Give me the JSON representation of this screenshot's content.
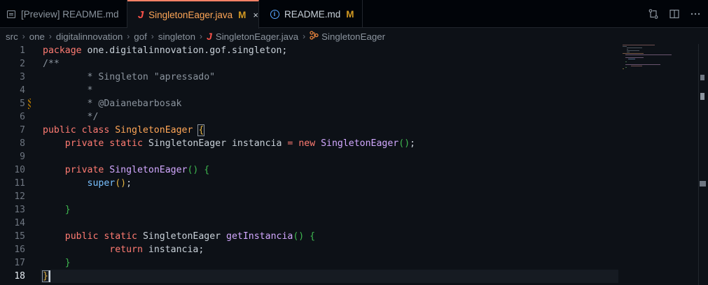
{
  "tabs": [
    {
      "label": "[Preview] README.md",
      "icon": "preview-icon",
      "active": false
    },
    {
      "label": "SingletonEager.java",
      "icon": "java-icon",
      "modified": "M",
      "active": true,
      "close": "×"
    },
    {
      "label": "README.md",
      "icon": "info-icon",
      "modified": "M",
      "active": false
    }
  ],
  "breadcrumb": [
    "src",
    "one",
    "digitalinnovation",
    "gof",
    "singleton",
    "SingletonEager.java",
    "SingletonEager"
  ],
  "breadcrumb_sep": "›",
  "current_line": 18,
  "line_numbers": [
    "1",
    "2",
    "3",
    "4",
    "5",
    "6",
    "7",
    "8",
    "9",
    "10",
    "11",
    "12",
    "13",
    "14",
    "15",
    "16",
    "17",
    "18"
  ],
  "code": {
    "l1_kw": "package",
    "l1_rest": " one.digitalinnovation.gof.singleton;",
    "l2": "/**",
    "l3": "        * Singleton \"apressado\"",
    "l4": "        *",
    "l5": "        * @Daianebarbosak",
    "l6": "        */",
    "l7_kw": "public class",
    "l7_cls": "SingletonEager",
    "l7_br": "{",
    "l8_kw": "private static",
    "l8_cls": "SingletonEager",
    "l8_id": "instancia",
    "l8_op": "=",
    "l8_new": "new",
    "l8_fn": "SingletonEager",
    "l8_par": "()",
    "l8_end": ";",
    "l10_kw": "private",
    "l10_fn": "SingletonEager",
    "l10_par": "()",
    "l10_br": "{",
    "l11_sp": "super",
    "l11_par": "()",
    "l11_end": ";",
    "l13_br": "}",
    "l15_kw": "public static",
    "l15_cls": "SingletonEager",
    "l15_fn": "getInstancia",
    "l15_par": "()",
    "l15_br": "{",
    "l16_kw": "return",
    "l16_id": "instancia;",
    "l17_br": "}",
    "l18_br": "}"
  },
  "colors": {
    "background": "#0d1117",
    "keyword": "#ff7b72",
    "class": "#ffa657",
    "function": "#d2a8ff",
    "comment": "#8b949e",
    "modified": "#d29922"
  }
}
